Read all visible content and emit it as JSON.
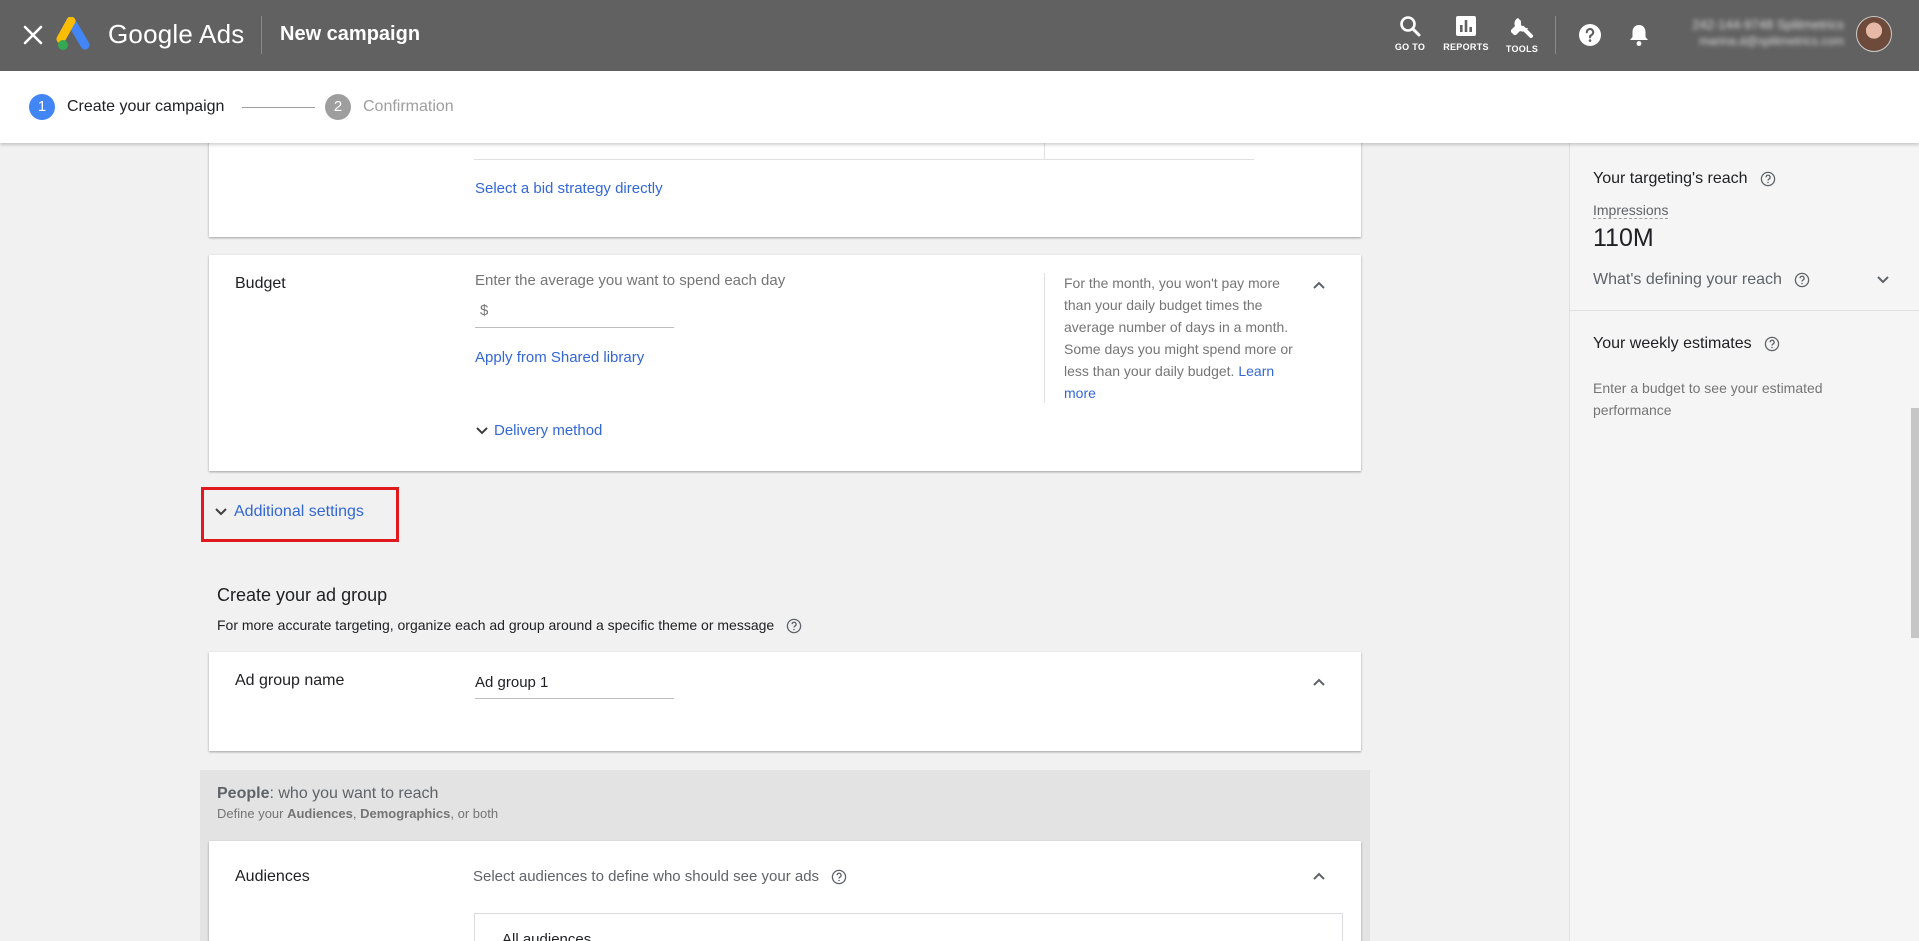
{
  "topbar": {
    "brand": "Google Ads",
    "page_title": "New campaign",
    "tools": [
      {
        "label": "GO TO",
        "icon": "search-icon"
      },
      {
        "label": "REPORTS",
        "icon": "bar-chart-icon"
      },
      {
        "label": "TOOLS",
        "icon": "wrench-icon"
      }
    ],
    "account_line1": "242-144-9748 Splitmetrics",
    "account_line2": "marina.d@splitmetrics.com"
  },
  "stepper": {
    "steps": [
      {
        "num": "1",
        "label": "Create your campaign",
        "active": true
      },
      {
        "num": "2",
        "label": "Confirmation",
        "active": false
      }
    ]
  },
  "bidding": {
    "bid_strategy_link": "Select a bid strategy directly"
  },
  "budget": {
    "title": "Budget",
    "prompt": "Enter the average you want to spend each day",
    "currency": "$",
    "value": "",
    "shared_library_link": "Apply from Shared library",
    "delivery_method": "Delivery method",
    "help_text": "For the month, you won't pay more than your daily budget times the average number of days in a month. Some days you might spend more or less than your daily budget.",
    "learn_more": "Learn more"
  },
  "additional_settings": {
    "label": "Additional settings"
  },
  "ad_group": {
    "heading": "Create your ad group",
    "description": "For more accurate targeting, organize each ad group around a specific theme or message",
    "name_label": "Ad group name",
    "name_value": "Ad group 1"
  },
  "people": {
    "title_bold": "People",
    "title_rest": ": who you want to reach",
    "sub_prefix": "Define your ",
    "sub_audiences": "Audiences",
    "sub_comma": ", ",
    "sub_demographics": "Demographics",
    "sub_suffix": ", or both"
  },
  "audiences": {
    "title": "Audiences",
    "prompt": "Select audiences to define who should see your ads",
    "box_text": "All audiences"
  },
  "right_panel": {
    "reach_title": "Your targeting's reach",
    "impressions_label": "Impressions",
    "impressions_value": "110M",
    "defining_reach": "What's defining your reach",
    "weekly_title": "Your weekly estimates",
    "weekly_text": "Enter a budget to see your estimated performance"
  },
  "colors": {
    "topbar_bg": "#616161",
    "accent_blue": "#3367d6",
    "step_active": "#4285f4",
    "step_inactive": "#9e9e9e",
    "highlight_red": "#e0191f"
  }
}
